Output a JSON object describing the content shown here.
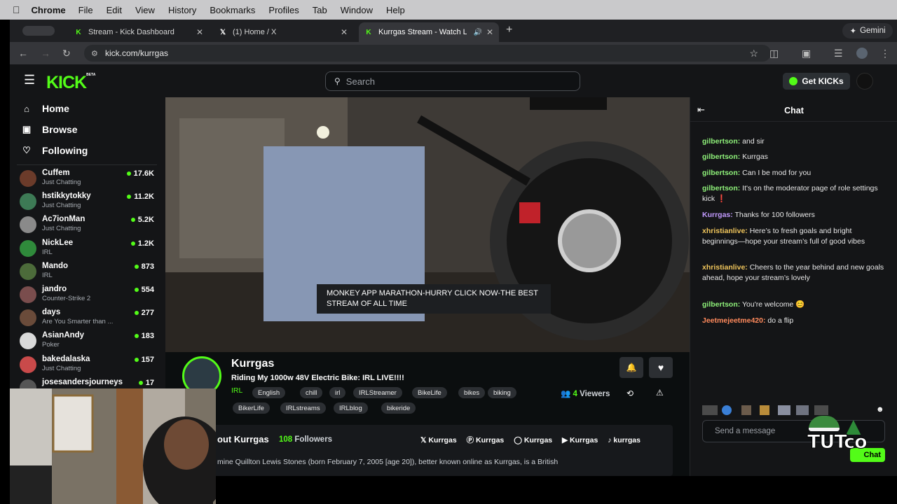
{
  "mac_menu": {
    "app": "Chrome",
    "items": [
      "File",
      "Edit",
      "View",
      "History",
      "Bookmarks",
      "Profiles",
      "Tab",
      "Window",
      "Help"
    ]
  },
  "tabs": [
    {
      "title": "Stream - Kick Dashboard"
    },
    {
      "title": "(1) Home / X"
    },
    {
      "title": "Kurrgas Stream - Watch L"
    }
  ],
  "gemini_label": "Gemini",
  "url": "kick.com/kurrgas",
  "header": {
    "logo": "KICK",
    "logo_badge": "BETA",
    "search_placeholder": "Search",
    "get_kicks": "Get KICKs"
  },
  "sidebar": {
    "nav": [
      "Home",
      "Browse",
      "Following"
    ],
    "channels": [
      {
        "name": "Cuffem",
        "category": "Just Chatting",
        "viewers": "17.6K",
        "color": "#6b3b2a"
      },
      {
        "name": "hstikkytokky",
        "category": "Just Chatting",
        "viewers": "11.2K",
        "color": "#3d7a55"
      },
      {
        "name": "Ac7ionMan",
        "category": "Just Chatting",
        "viewers": "5.2K",
        "color": "#8a8a8a"
      },
      {
        "name": "NickLee",
        "category": "IRL",
        "viewers": "1.2K",
        "color": "#2f8a3b"
      },
      {
        "name": "Mando",
        "category": "IRL",
        "viewers": "873",
        "color": "#4c6b3a"
      },
      {
        "name": "jandro",
        "category": "Counter-Strike 2",
        "viewers": "554",
        "color": "#7a4d4d"
      },
      {
        "name": "days",
        "category": "Are You Smarter than ...",
        "viewers": "277",
        "color": "#6a4b3a"
      },
      {
        "name": "AsianAndy",
        "category": "Poker",
        "viewers": "183",
        "color": "#d9d9d9"
      },
      {
        "name": "bakedalaska",
        "category": "Just Chatting",
        "viewers": "157",
        "color": "#c94a4a"
      },
      {
        "name": "josesandersjourneys",
        "category": "",
        "viewers": "17",
        "color": "#555555"
      }
    ]
  },
  "video": {
    "overlay_text": "MONKEY APP MARATHON-HURRY CLICK NOW-THE BEST STREAM OF ALL TIME"
  },
  "stream": {
    "channel": "Kurrgas",
    "title": "Riding My 1000w 48V Electric Bike: IRL LIVE!!!!",
    "category": "IRL",
    "tags": [
      "English",
      "chill",
      "irl",
      "IRLStreamer",
      "BikeLife",
      "bikes",
      "biking",
      "BikerLife",
      "IRLstreams",
      "IRLblog",
      "bikeride"
    ],
    "viewers_count": "4",
    "viewers_label": "Viewers"
  },
  "about": {
    "heading": "out Kurrgas",
    "followers_count": "108",
    "followers_label": "Followers",
    "socials": [
      "Kurrgas",
      "Kurrgas",
      "Kurrgas",
      "Kurrgas",
      "kurrgas"
    ],
    "bio": "mine Quillton Lewis Stones (born February 7, 2005 [age 20]), better known online as Kurrgas, is a British"
  },
  "chat": {
    "title": "Chat",
    "messages": [
      {
        "user": "gilbertson:",
        "text": " and sir",
        "color": "#8ff27a"
      },
      {
        "user": "gilbertson:",
        "text": " Kurrgas",
        "color": "#8ff27a"
      },
      {
        "user": "gilbertson:",
        "text": " Can I be mod for you",
        "color": "#8ff27a"
      },
      {
        "user": "gilbertson:",
        "text": " It's on the moderator page of role settings kick ❗",
        "color": "#8ff27a"
      },
      {
        "user": "Kurrgas:",
        "text": " Thanks for 100 followers",
        "color": "#c39bff"
      },
      {
        "user": "xhristianlive:",
        "text": " Here’s to fresh goals and bright beginnings—hope your stream’s full of good vibes",
        "color": "#f2c75c"
      },
      {
        "user": "xhristianlive:",
        "text": " Cheers to the year behind and new goals ahead, hope your stream’s lovely",
        "color": "#f2c75c"
      },
      {
        "user": "gilbertson:",
        "text": " You're welcome 😊",
        "color": "#8ff27a"
      },
      {
        "user": "Jeetmejeetme420:",
        "text": " do a flip",
        "color": "#ff8a5c"
      }
    ],
    "input_placeholder": "Send a message",
    "send_label": "Chat"
  },
  "overlay": {
    "tutco_logo": "TUTco"
  },
  "colors": {
    "accent": "#53fc18"
  }
}
